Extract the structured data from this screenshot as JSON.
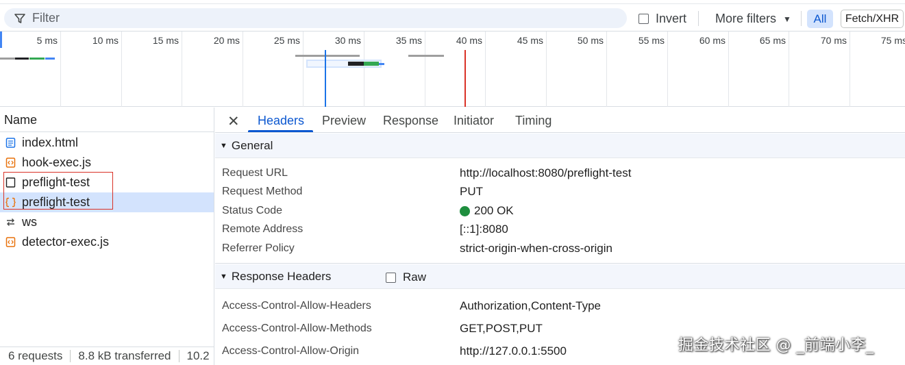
{
  "filter": {
    "placeholder": "Filter",
    "invert_label": "Invert",
    "more_filters_label": "More filters",
    "chip_all": "All",
    "chip_fetch": "Fetch/XHR"
  },
  "timeline": {
    "tick_labels": [
      "5 ms",
      "10 ms",
      "15 ms",
      "20 ms",
      "25 ms",
      "30 ms",
      "35 ms",
      "40 ms",
      "45 ms",
      "50 ms",
      "55 ms",
      "60 ms",
      "65 ms",
      "70 ms",
      "75 ms"
    ]
  },
  "request_list": {
    "header": "Name",
    "items": [
      {
        "name": "index.html",
        "icon": "document-icon"
      },
      {
        "name": "hook-exec.js",
        "icon": "script-icon"
      },
      {
        "name": "preflight-test",
        "icon": "blank-file-icon"
      },
      {
        "name": "preflight-test",
        "icon": "fetch-icon",
        "selected": true
      },
      {
        "name": "ws",
        "icon": "websocket-icon"
      },
      {
        "name": "detector-exec.js",
        "icon": "script-icon"
      }
    ],
    "status": {
      "requests": "6 requests",
      "transferred": "8.8 kB transferred",
      "resources": "10.2"
    }
  },
  "details": {
    "tabs": [
      "Headers",
      "Preview",
      "Response",
      "Initiator",
      "Timing"
    ],
    "active_tab": "Headers",
    "general": {
      "title": "General",
      "rows": [
        {
          "key": "Request URL",
          "value": "http://localhost:8080/preflight-test"
        },
        {
          "key": "Request Method",
          "value": "PUT"
        },
        {
          "key": "Status Code",
          "value": "200 OK"
        },
        {
          "key": "Remote Address",
          "value": "[::1]:8080"
        },
        {
          "key": "Referrer Policy",
          "value": "strict-origin-when-cross-origin"
        }
      ]
    },
    "response_headers": {
      "title": "Response Headers",
      "raw_label": "Raw",
      "rows": [
        {
          "key": "Access-Control-Allow-Headers",
          "value": "Authorization,Content-Type"
        },
        {
          "key": "Access-Control-Allow-Methods",
          "value": "GET,POST,PUT"
        },
        {
          "key": "Access-Control-Allow-Origin",
          "value": "http://127.0.0.1:5500"
        }
      ]
    }
  },
  "watermark": "掘金技术社区 @ _前端小李_",
  "colors": {
    "accent": "#0b57d0",
    "selected_bg": "#d3e3fd",
    "status_ok": "#1e8e3e",
    "highlight": "#d93025"
  }
}
